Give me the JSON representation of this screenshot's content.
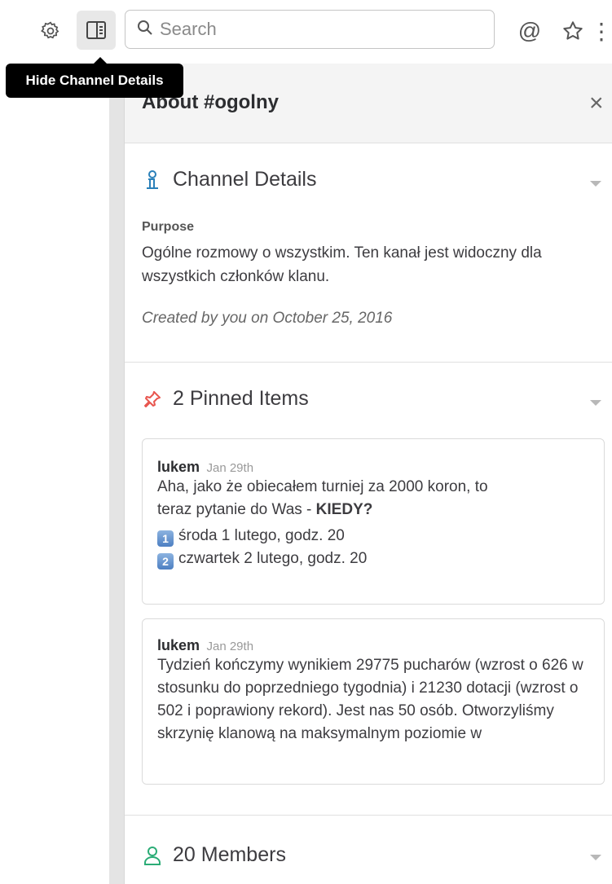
{
  "toolbar": {
    "search_placeholder": "Search",
    "at_symbol": "@",
    "more_symbol": "⋮",
    "tooltip": "Hide Channel Details"
  },
  "panel": {
    "title": "About #ogolny",
    "close_symbol": "×"
  },
  "channel_details": {
    "heading": "Channel Details",
    "purpose_label": "Purpose",
    "purpose_text": "Ogólne rozmowy o  wszystkim. Ten kanał jest widoczny dla wszystkich członków klanu.",
    "created": "Created by you on October 25, 2016"
  },
  "pinned": {
    "heading": "2 Pinned Items",
    "items": [
      {
        "author": "lukem",
        "date": "Jan 29th",
        "line1": "Aha, jako że obiecałem turniej za 2000 koron, to",
        "line2_prefix": "teraz pytanie do Was - ",
        "line2_bold": "KIEDY?",
        "option1_num": "1",
        "option1": "środa 1 lutego, godz. 20",
        "option2_num": "2",
        "option2": "czwartek 2 lutego, godz. 20"
      },
      {
        "author": "lukem",
        "date": "Jan 29th",
        "text": "Tydzień kończymy wynikiem 29775 pucharów (wzrost o 626 w stosunku do poprzedniego tygodnia) i 21230 dotacji (wzrost o 502 i poprawiony rekord). Jest nas 50 osób. Otworzyliśmy skrzynię klanową na maksymalnym poziomie w"
      }
    ]
  },
  "members": {
    "heading": "20 Members"
  },
  "colors": {
    "pin_icon": "#e8564f",
    "channel_icon": "#2a80b9",
    "members_icon": "#2bac76"
  }
}
